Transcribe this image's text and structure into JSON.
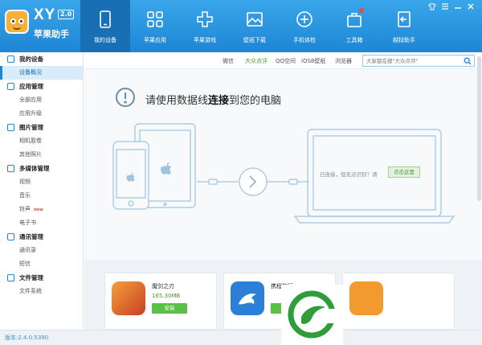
{
  "brand": {
    "name": "XY",
    "version": "2.0",
    "subtitle": "苹果助手"
  },
  "nav": [
    {
      "label": "我的设备",
      "icon": "phone-icon",
      "active": true
    },
    {
      "label": "苹果应用",
      "icon": "apps-grid-icon"
    },
    {
      "label": "苹果游戏",
      "icon": "gamepad-plus-icon"
    },
    {
      "label": "壁纸下载",
      "icon": "image-icon"
    },
    {
      "label": "手机体检",
      "icon": "checkup-plus-icon"
    },
    {
      "label": "工具箱",
      "icon": "toolbox-icon",
      "badge": true
    },
    {
      "label": "越狱助手",
      "icon": "jailbreak-icon"
    }
  ],
  "window_controls": [
    "skin-icon",
    "menu-icon",
    "minimize-icon",
    "close-icon"
  ],
  "sidebar": [
    {
      "group": "我的设备",
      "icon": "device-icon",
      "items": [
        {
          "label": "设备概况",
          "active": true
        }
      ]
    },
    {
      "group": "应用管理",
      "icon": "apps-icon",
      "items": [
        {
          "label": "全部应用"
        },
        {
          "label": "应用升级"
        }
      ]
    },
    {
      "group": "图片管理",
      "icon": "picture-icon",
      "items": [
        {
          "label": "相机胶卷"
        },
        {
          "label": "其他照片"
        }
      ]
    },
    {
      "group": "多媒体管理",
      "icon": "media-icon",
      "items": [
        {
          "label": "视频"
        },
        {
          "label": "音乐"
        },
        {
          "label": "铃声",
          "new": "new"
        },
        {
          "label": "电子书"
        }
      ]
    },
    {
      "group": "通讯管理",
      "icon": "contacts-icon",
      "items": [
        {
          "label": "通讯录"
        },
        {
          "label": "短信"
        }
      ]
    },
    {
      "group": "文件管理",
      "icon": "folder-icon",
      "items": [
        {
          "label": "文件系统"
        }
      ]
    }
  ],
  "status_bar": {
    "version": "版本:2.4.0.5390"
  },
  "toolbar": {
    "links": [
      {
        "label": "微信"
      },
      {
        "label": "大众点评",
        "hot": true
      },
      {
        "label": "QQ空间"
      },
      {
        "label": "iOS8壁纸"
      },
      {
        "label": "浏览器"
      }
    ],
    "search_placeholder": "大家都在搜\"大众点评\""
  },
  "hero": {
    "message_pre": "请使用数据线",
    "message_bold": "连接",
    "message_post": "到您的电脑",
    "connected_text": "已连接，但无法识别？请",
    "connect_button": "点击这里"
  },
  "apps": [
    {
      "name": "魔剑之刃",
      "size": "165.30MB",
      "install": "安装",
      "icon_color": "#d04b2a"
    },
    {
      "name": "携程旅行",
      "size": "",
      "install": "安装",
      "icon_color": "#2b7fd6"
    },
    {
      "name": "",
      "size": "",
      "install": "",
      "icon_color": "#f29a2e"
    }
  ]
}
